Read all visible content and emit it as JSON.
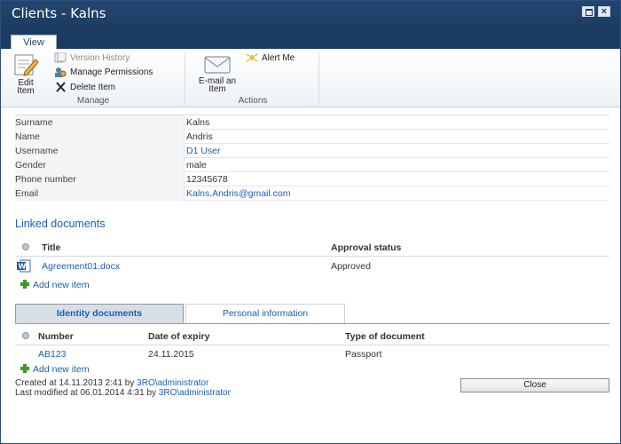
{
  "window": {
    "title": "Clients - Kalns"
  },
  "ribbon": {
    "tab": "View",
    "manage": {
      "label": "Manage",
      "edit_item": "Edit Item",
      "version_history": "Version History",
      "manage_permissions": "Manage Permissions",
      "delete_item": "Delete Item"
    },
    "actions": {
      "label": "Actions",
      "email_item": "E-mail an Item",
      "alert_me": "Alert Me"
    }
  },
  "fields": [
    {
      "label": "Surname",
      "value": "Kalns",
      "link": false
    },
    {
      "label": "Name",
      "value": "Andris",
      "link": false
    },
    {
      "label": "Username",
      "value": "D1 User",
      "link": true
    },
    {
      "label": "Gender",
      "value": "male",
      "link": false
    },
    {
      "label": "Phone number",
      "value": "12345678",
      "link": false
    },
    {
      "label": "Email",
      "value": "Kalns.Andris@gmail.com",
      "link": true
    }
  ],
  "linked_documents": {
    "title": "Linked documents",
    "columns": {
      "title": "Title",
      "approval": "Approval status"
    },
    "rows": [
      {
        "title": "Agreement01.docx",
        "approval": "Approved"
      }
    ],
    "add_new": "Add new item"
  },
  "tabs": {
    "identity": "Identity documents",
    "personal": "Personal information"
  },
  "identity_documents": {
    "columns": {
      "number": "Number",
      "expiry": "Date of expiry",
      "type": "Type of document"
    },
    "rows": [
      {
        "number": "AB123",
        "expiry": "24.11.2015",
        "type": "Passport"
      }
    ],
    "add_new": "Add new item"
  },
  "footer": {
    "created_prefix": "Created at 14.11.2013 2:41 by",
    "created_by": "3RO\\administrator",
    "modified_prefix": "Last modified at 06.01.2014 4:31 by",
    "modified_by": "3RO\\administrator"
  },
  "close_label": "Close",
  "icons": {
    "edit": "edit-item-icon",
    "version": "version-history-icon",
    "permissions": "manage-permissions-icon",
    "delete": "delete-x-icon",
    "email": "email-envelope-icon",
    "alert": "alert-me-icon",
    "word": "word-document-icon",
    "add": "green-plus-icon"
  }
}
